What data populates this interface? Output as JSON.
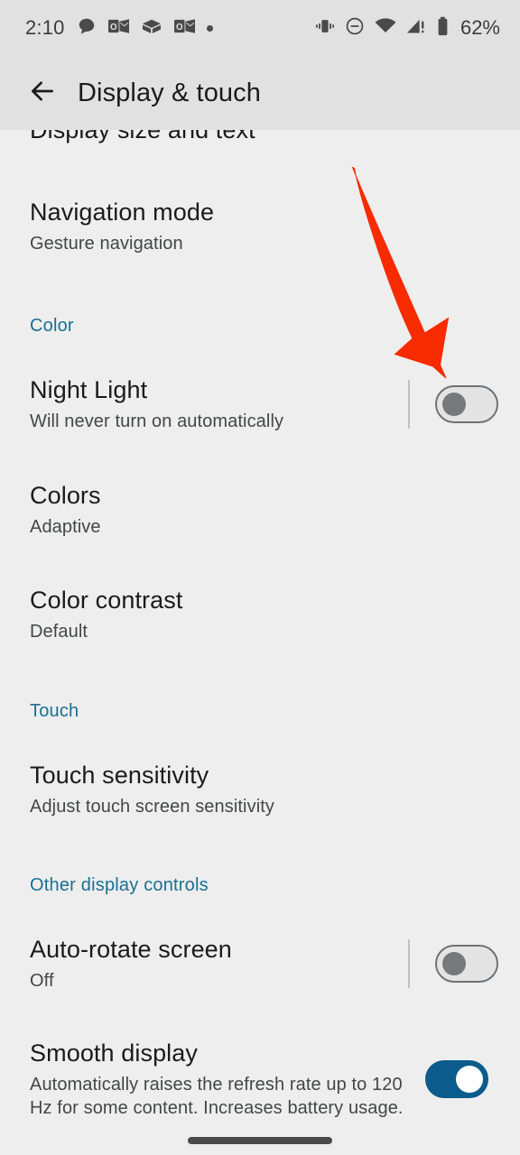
{
  "status_bar": {
    "time": "2:10",
    "battery_percent": "62%",
    "left_icons": [
      "chat-bubble-icon",
      "outlook-mail-icon",
      "package-box-icon",
      "outlook-mail-icon",
      "notification-dot-icon"
    ],
    "right_icons": [
      "vibrate-icon",
      "do-not-disturb-icon",
      "wifi-icon",
      "cellular-signal-alert-icon",
      "battery-icon"
    ]
  },
  "app_bar": {
    "back_icon": "back-arrow-icon",
    "title": "Display & touch"
  },
  "content": {
    "clipped_row": {
      "title": "Display size and text"
    },
    "items": [
      {
        "title": "Navigation mode",
        "subtitle": "Gesture navigation"
      }
    ],
    "sections": [
      {
        "header": "Color",
        "items": [
          {
            "title": "Night Light",
            "subtitle": "Will never turn on automatically",
            "toggle": "off"
          },
          {
            "title": "Colors",
            "subtitle": "Adaptive"
          },
          {
            "title": "Color contrast",
            "subtitle": "Default"
          }
        ]
      },
      {
        "header": "Touch",
        "items": [
          {
            "title": "Touch sensitivity",
            "subtitle": "Adjust touch screen sensitivity"
          }
        ]
      },
      {
        "header": "Other display controls",
        "items": [
          {
            "title": "Auto-rotate screen",
            "subtitle": "Off",
            "toggle": "off"
          },
          {
            "title": "Smooth display",
            "subtitle": "Automatically raises the refresh rate up to 120 Hz for some content. Increases battery usage.",
            "toggle": "on"
          }
        ]
      }
    ]
  },
  "annotation": {
    "arrow_color": "#f62b00",
    "points_at": "Night Light toggle"
  },
  "colors": {
    "accent_blue": "#0b5c8c",
    "section_header_blue": "#1a6f93",
    "appbar_background": "#e1e1e1",
    "page_background": "#eeeeee"
  },
  "gesture_bar": {
    "handle": "home-gesture-pill"
  }
}
